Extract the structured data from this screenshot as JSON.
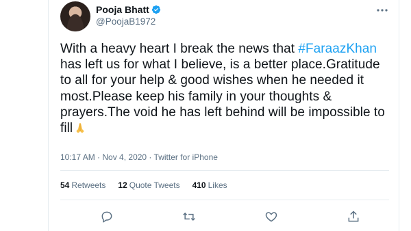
{
  "author": {
    "display_name": "Pooja Bhatt",
    "handle": "@PoojaB1972",
    "verified": true
  },
  "tweet": {
    "text_before_hashtag": "With a heavy heart I break the news that ",
    "hashtag": "#FaraazKhan",
    "text_after_hashtag": " has left us for what I believe, is a better place.Gratitude to all for your help & good wishes when he needed it most.Please keep his family in your thoughts & prayers.The void he has left behind will be impossible to fill",
    "emoji": "folded-hands"
  },
  "meta": {
    "time": "10:17 AM",
    "separator1": " · ",
    "date": "Nov 4, 2020",
    "separator2": " · ",
    "source": "Twitter for iPhone"
  },
  "stats": {
    "retweets_count": "54",
    "retweets_label": "Retweets",
    "quotes_count": "12",
    "quotes_label": "Quote Tweets",
    "likes_count": "410",
    "likes_label": "Likes"
  },
  "actions": [
    "reply-icon",
    "retweet-icon",
    "like-icon",
    "share-icon"
  ],
  "colors": {
    "text": "#0f1419",
    "secondary": "#5b7083",
    "accent": "#1da1f2",
    "divider": "#e6ecf0"
  }
}
